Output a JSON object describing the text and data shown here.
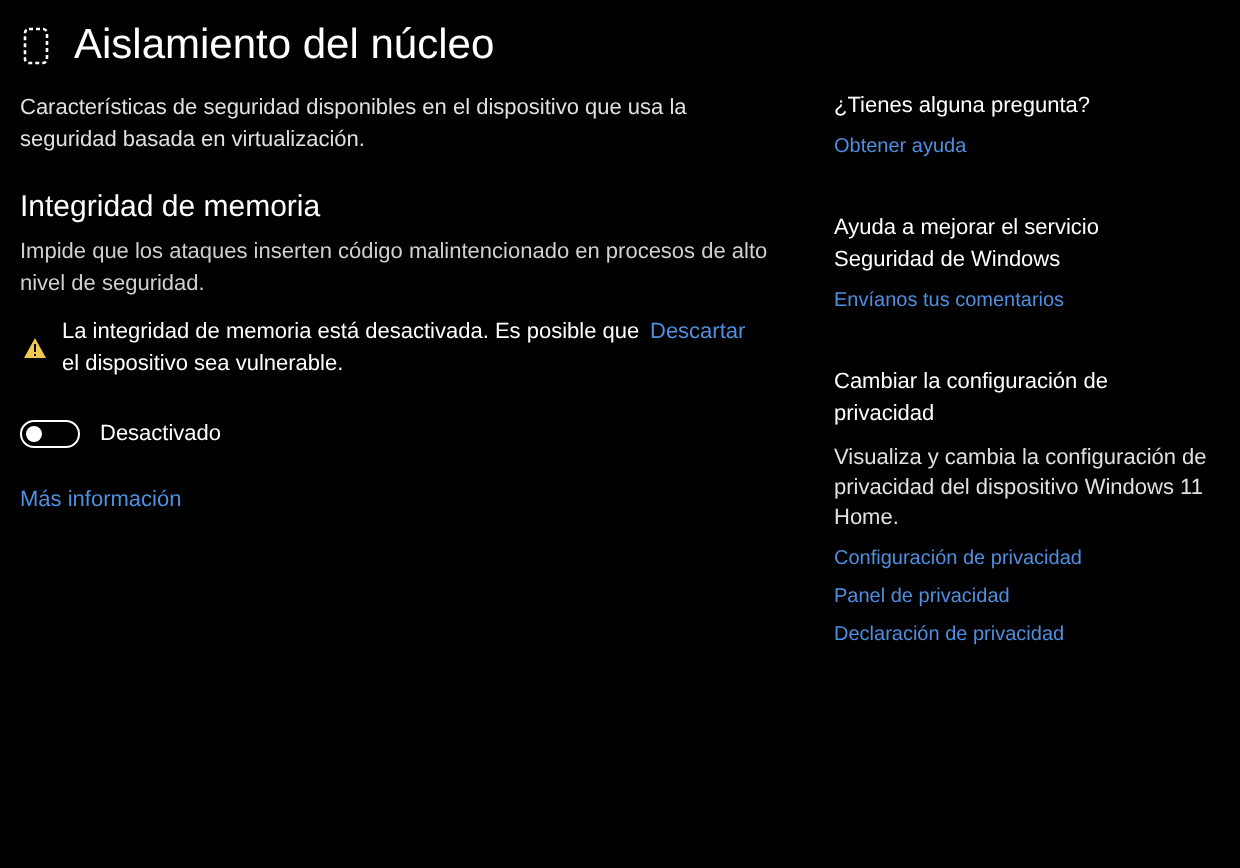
{
  "page": {
    "title": "Aislamiento del núcleo",
    "description": "Características de seguridad disponibles en el dispositivo que usa la seguridad basada en virtualización."
  },
  "section": {
    "title": "Integridad de memoria",
    "description": "Impide que los ataques inserten código malintencionado en procesos de alto nivel de seguridad.",
    "warning": {
      "text": "La integridad de memoria está desactivada. Es posible que el dispositivo sea vulnerable.",
      "action": "Descartar"
    },
    "toggle": {
      "on": false,
      "label": "Desactivado"
    },
    "link": "Más información"
  },
  "sidebar": [
    {
      "title": "¿Tienes alguna pregunta?",
      "links": [
        "Obtener ayuda"
      ]
    },
    {
      "title": "Ayuda a mejorar el servicio Seguridad de Windows",
      "links": [
        "Envíanos tus comentarios"
      ]
    },
    {
      "title": "Cambiar la configuración de privacidad",
      "description": "Visualiza y cambia la configuración de privacidad del dispositivo Windows 11 Home.",
      "links": [
        "Configuración de privacidad",
        "Panel de privacidad",
        "Declaración de privacidad"
      ]
    }
  ]
}
